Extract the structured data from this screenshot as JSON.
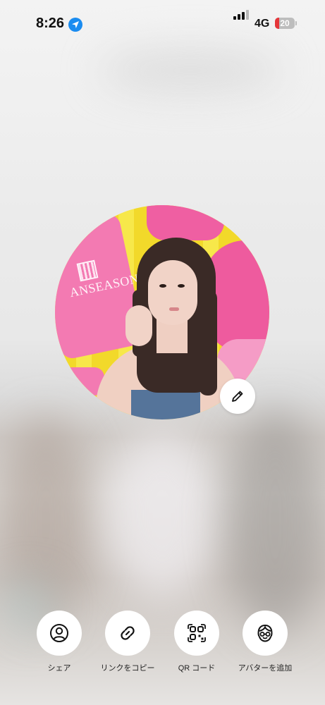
{
  "status_bar": {
    "time": "8:26",
    "network": "4G",
    "battery_level": "20",
    "battery_fraction": 0.2,
    "battery_color": "#e5363a",
    "location_color": "#1a8cf0"
  },
  "avatar": {
    "brand_text": "ANSEASON",
    "edit_icon": "pencil-icon"
  },
  "actions": [
    {
      "label": "シェア",
      "icon": "person-circle-icon"
    },
    {
      "label": "リンクをコピー",
      "icon": "link-icon"
    },
    {
      "label": "QR コード",
      "icon": "qr-code-icon"
    },
    {
      "label": "アバターを追加",
      "icon": "avatar-face-icon"
    }
  ]
}
